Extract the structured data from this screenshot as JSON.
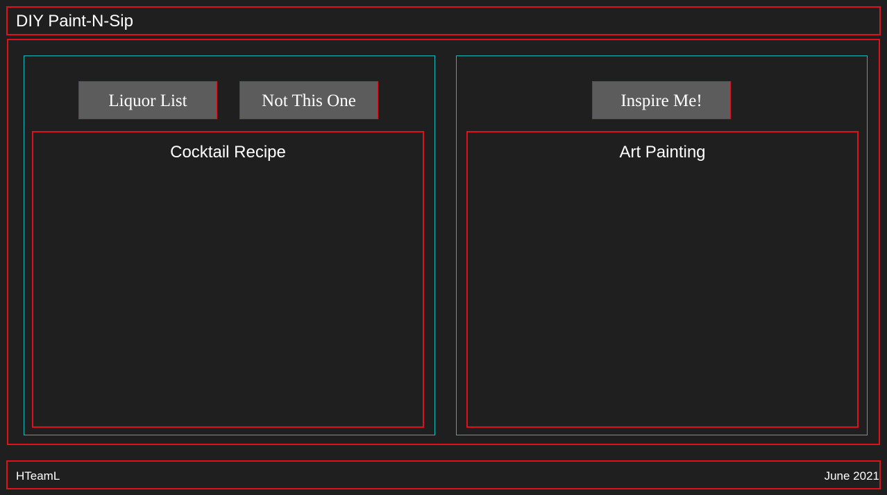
{
  "header": {
    "title": "DIY Paint-N-Sip"
  },
  "cocktail_panel": {
    "buttons": {
      "liquor_list": "Liquor List",
      "not_this_one": "Not This One"
    },
    "box_title": "Cocktail Recipe"
  },
  "art_panel": {
    "buttons": {
      "inspire_me": "Inspire Me!"
    },
    "box_title": "Art Painting"
  },
  "footer": {
    "left_text": "HTeamL",
    "right_text": "June 2021"
  },
  "colors": {
    "background": "#1f1f1f",
    "border_red": "#e0101d",
    "border_cyan": "#18b9bd",
    "button_bg": "#5c5c5c"
  }
}
